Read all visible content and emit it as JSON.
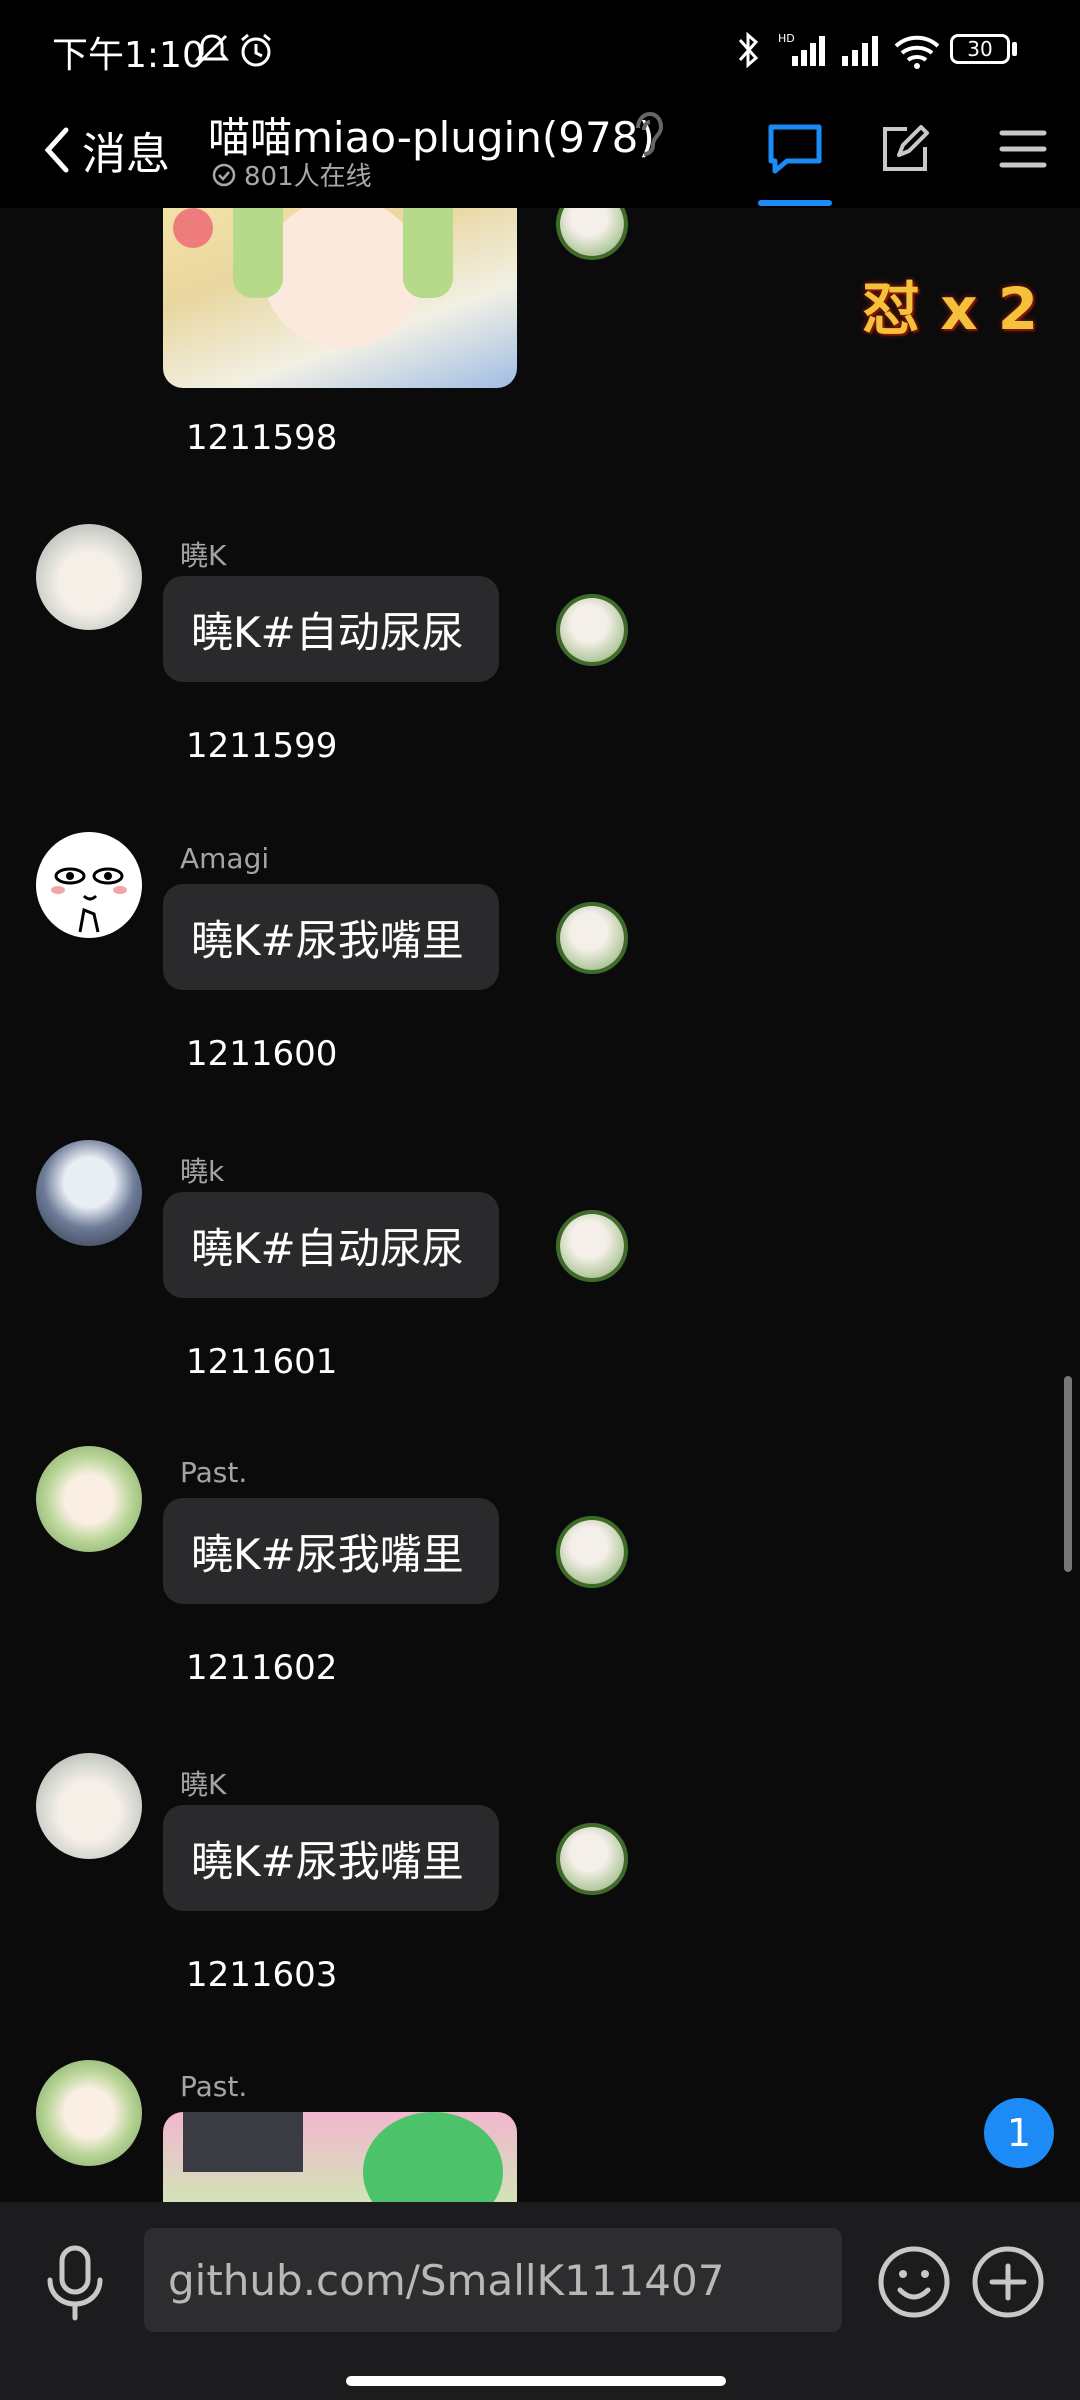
{
  "status_bar": {
    "time": "下午1:10",
    "battery": "30"
  },
  "header": {
    "back_label": "消息",
    "group_title": "喵喵miao-plugin(978)",
    "online_text": "801人在线"
  },
  "combo_label": "怼 x 2",
  "messages": [
    {
      "sender": "",
      "type": "image",
      "number": "1211598"
    },
    {
      "sender": "曉K",
      "type": "text",
      "text": "曉K#自动尿尿",
      "number": "1211599"
    },
    {
      "sender": "Amagi",
      "type": "text",
      "text": "曉K#尿我嘴里",
      "number": "1211600"
    },
    {
      "sender": "曉k",
      "type": "text",
      "text": "曉K#自动尿尿",
      "number": "1211601"
    },
    {
      "sender": "Past.",
      "type": "text",
      "text": "曉K#尿我嘴里",
      "number": "1211602"
    },
    {
      "sender": "曉K",
      "type": "text",
      "text": "曉K#尿我嘴里",
      "number": "1211603"
    },
    {
      "sender": "Past.",
      "type": "image"
    }
  ],
  "unread_badge": "1",
  "input": {
    "value": "github.com/SmallK111407"
  },
  "icons": [
    "bluetooth-icon",
    "signal-icon",
    "wifi-icon",
    "battery-icon",
    "chevron-left-icon",
    "ear-icon",
    "chat-icon",
    "edit-icon",
    "menu-icon",
    "mic-icon",
    "emoji-icon",
    "plus-icon"
  ],
  "colors": {
    "accent": "#1c8bf6",
    "background": "#0b0b0c",
    "bubble": "#2a2a2c"
  }
}
